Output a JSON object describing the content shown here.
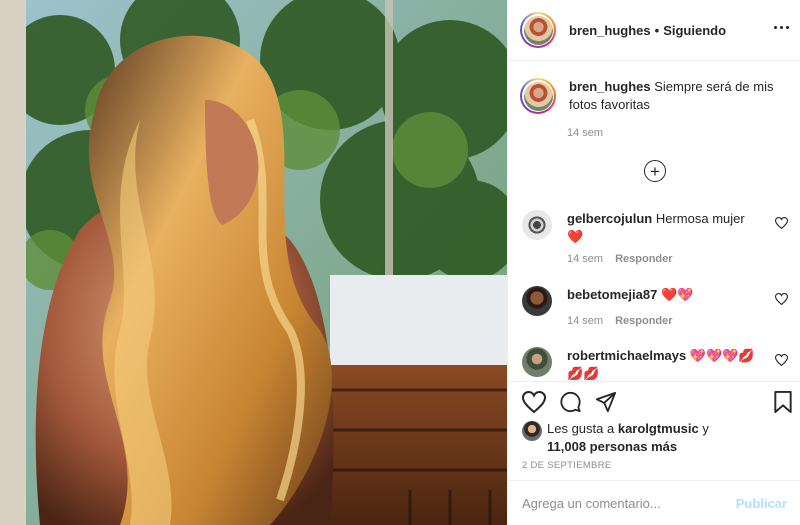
{
  "post": {
    "username": "bren_hughes",
    "separator": "•",
    "follow_label": "Siguiendo",
    "caption_text": "Siempre será de mis fotos favoritas",
    "caption_time": "14 sem"
  },
  "comments": [
    {
      "username": "gelbercojulun",
      "text": "Hermosa mujer",
      "emoji": "❤️",
      "time": "14 sem",
      "reply": "Responder"
    },
    {
      "username": "bebetomejia87",
      "text": "",
      "emoji": "❤️💖",
      "time": "14 sem",
      "reply": "Responder"
    },
    {
      "username": "robertmichaelmays",
      "text": "",
      "emoji": "💖💖💖💋",
      "emoji2": "💋💋",
      "time": "",
      "reply": ""
    }
  ],
  "likes": {
    "prefix": "Les gusta a",
    "user": "karolgtmusic",
    "joiner": "y",
    "count": "11,008 personas más"
  },
  "date": "2 DE SEPTIEMBRE",
  "add_comment": {
    "placeholder": "Agrega un comentario...",
    "post_label": "Publicar"
  },
  "icons": {
    "more": "more-options-icon",
    "add": "load-more-comments-icon",
    "like": "heart-icon",
    "comment": "comment-bubble-icon",
    "share": "paper-plane-icon",
    "save": "bookmark-icon"
  },
  "colors": {
    "heart": "#e0245e",
    "publish_disabled": "#b2dffc",
    "muted": "#8e8e8e",
    "text": "#262626"
  }
}
